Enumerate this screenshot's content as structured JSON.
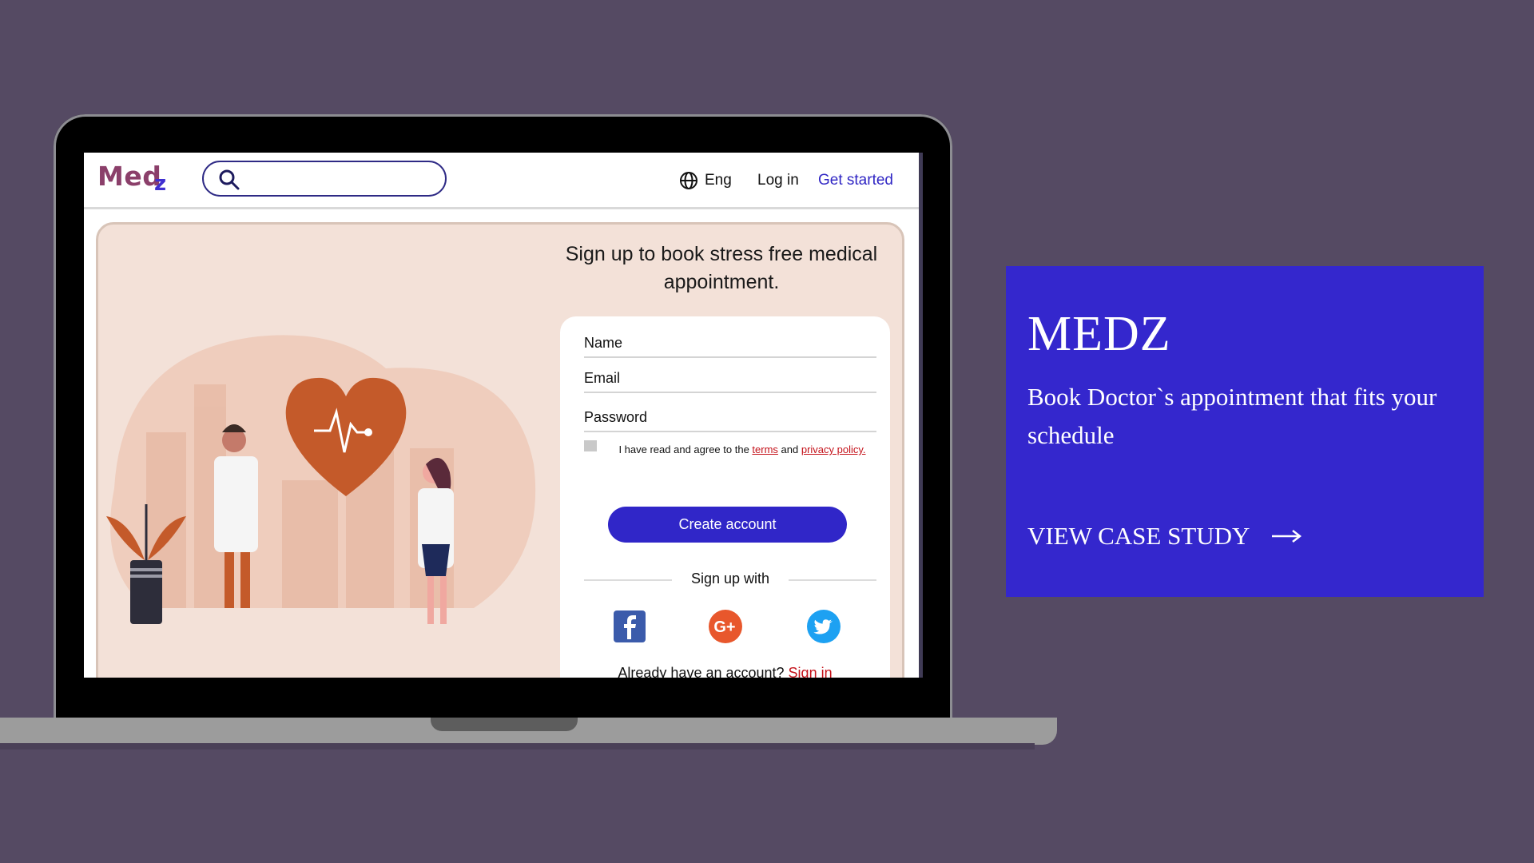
{
  "site": {
    "logo": "Med",
    "logo_suffix": "z",
    "search_placeholder": "",
    "language": "Eng",
    "login_label": "Log in",
    "get_started_label": "Get started"
  },
  "signup": {
    "title": "Sign up to book stress free medical appointment.",
    "name_label": "Name",
    "email_label": "Email",
    "password_label": "Password",
    "agree_prefix": "I have read and agree to the ",
    "terms_label": "terms",
    "agree_and": " and ",
    "privacy_label": "privacy policy.",
    "create_button": "Create account",
    "signup_with": "Sign up with",
    "already_text": "Already have an account? ",
    "sign_in_label": "Sign in",
    "social_icons": [
      "facebook-icon",
      "google-plus-icon",
      "twitter-icon"
    ]
  },
  "case_study": {
    "title": "MEDZ",
    "description": "Book Doctor`s appointment that fits your schedule",
    "cta": "VIEW CASE STUDY"
  },
  "colors": {
    "background": "#554a63",
    "accent": "#3427cd",
    "hero_bg": "#f3e1d8",
    "link_red": "#c4121a",
    "illustration_orange": "#c45a2a"
  }
}
